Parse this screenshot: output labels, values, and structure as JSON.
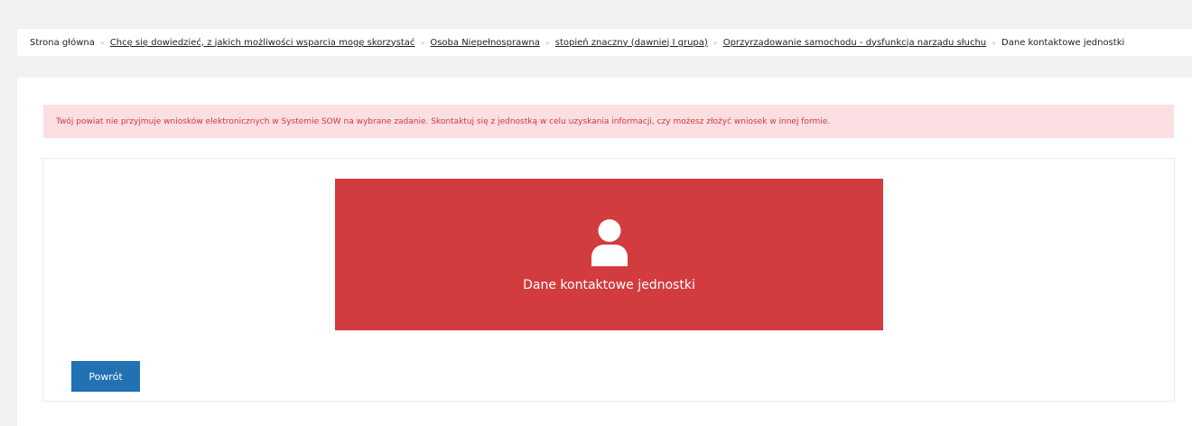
{
  "breadcrumb": {
    "items": [
      {
        "label": "Strona główna",
        "link": false
      },
      {
        "label": "Chcę się dowiedzieć, z jakich możliwości wsparcia mogę skorzystać",
        "link": true
      },
      {
        "label": "Osoba Niepełnosprawna",
        "link": true
      },
      {
        "label": "stopień znaczny (dawniej I grupa)",
        "link": true
      },
      {
        "label": "Oprzyrządowanie samochodu - dysfunkcja narządu słuchu",
        "link": true
      },
      {
        "label": "Dane kontaktowe jednostki",
        "link": false
      }
    ],
    "separator": "»"
  },
  "alert": {
    "text": "Twój powiat nie przyjmuje wniosków elektronicznych w Systemie SOW na wybrane zadanie. Skontaktuj się z jednostką w celu uzyskania informacji, czy możesz złożyć wniosek w innej formie."
  },
  "tile": {
    "icon": "user-icon",
    "label": "Dane kontaktowe jednostki"
  },
  "buttons": {
    "back_label": "Powrót"
  },
  "colors": {
    "page_background": "#f2f2f2",
    "alert_background": "#fbdfe2",
    "alert_text": "#cf3b3b",
    "tile_background": "#d23c3f",
    "button_background": "#2271b3"
  }
}
